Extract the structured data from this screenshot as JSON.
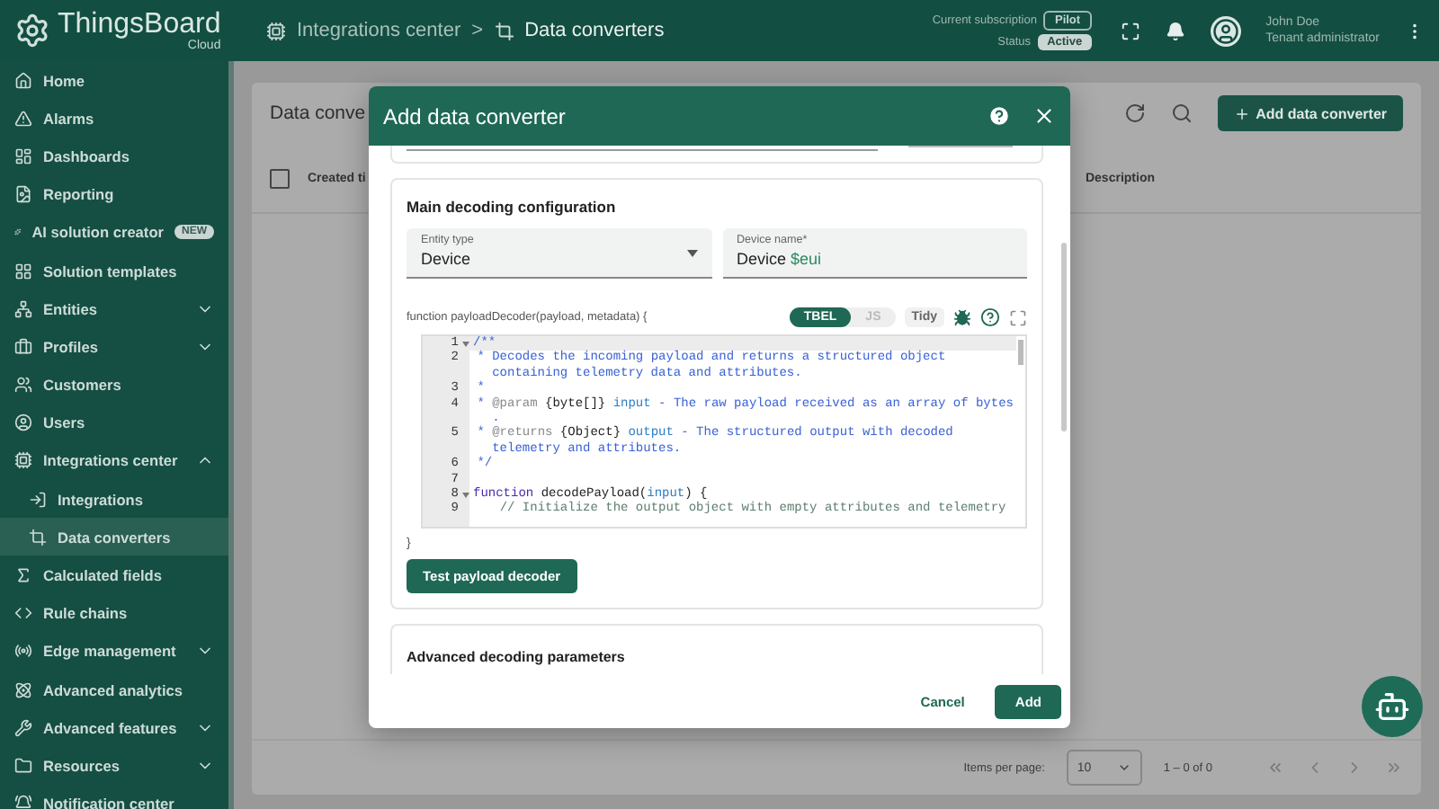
{
  "header": {
    "brand": "ThingsBoard",
    "brand_sub": "Cloud",
    "breadcrumb": [
      {
        "label": "Integrations center"
      },
      {
        "label": "Data converters"
      }
    ],
    "separator": ">",
    "subscription": {
      "label": "Current subscription",
      "value": "Pilot"
    },
    "status": {
      "label": "Status",
      "value": "Active"
    },
    "user": {
      "name": "John Doe",
      "role": "Tenant administrator"
    }
  },
  "sidebar": {
    "items": [
      {
        "label": "Home",
        "selected": false
      },
      {
        "label": "Alarms",
        "selected": false
      },
      {
        "label": "Dashboards",
        "selected": false
      },
      {
        "label": "Reporting",
        "selected": false
      },
      {
        "label": "AI solution creator",
        "badge": "NEW",
        "selected": false
      },
      {
        "label": "Solution templates",
        "selected": false
      },
      {
        "label": "Entities",
        "expanded": false,
        "selected": false
      },
      {
        "label": "Profiles",
        "expanded": false,
        "selected": false
      },
      {
        "label": "Customers",
        "selected": false
      },
      {
        "label": "Users",
        "selected": false
      },
      {
        "label": "Integrations center",
        "expanded": true,
        "selected": false,
        "children": [
          {
            "label": "Integrations",
            "selected": false
          },
          {
            "label": "Data converters",
            "selected": true
          }
        ]
      },
      {
        "label": "Calculated fields",
        "selected": false
      },
      {
        "label": "Rule chains",
        "selected": false
      },
      {
        "label": "Edge management",
        "expanded": false,
        "selected": false
      },
      {
        "label": "Advanced analytics",
        "selected": false
      },
      {
        "label": "Advanced features",
        "expanded": false,
        "selected": false
      },
      {
        "label": "Resources",
        "expanded": false,
        "selected": false
      },
      {
        "label": "Notification center",
        "selected": false
      }
    ]
  },
  "page": {
    "title": "Data conve",
    "select_all": {
      "checked": false
    },
    "add_button": "Add data converter",
    "columns": [
      "Created ti",
      "Description"
    ],
    "pagination": {
      "label": "Items per page:",
      "page_size": "10",
      "range": "1 – 0 of 0"
    }
  },
  "dialog": {
    "title": "Add data converter",
    "main_section": {
      "title": "Main decoding configuration",
      "entity_type": {
        "label": "Entity type",
        "value": "Device"
      },
      "device_name": {
        "label": "Device name*",
        "value_parts": [
          {
            "text": "Device ",
            "kind": "plain"
          },
          {
            "text": "$eui",
            "kind": "variable"
          }
        ]
      },
      "decoder": {
        "signature": "function payloadDecoder(payload, metadata) {",
        "languages": [
          {
            "label": "TBEL",
            "selected": true
          },
          {
            "label": "JS",
            "selected": false
          }
        ],
        "tidy_label": "Tidy",
        "closing": "}",
        "lines": [
          {
            "number": "1",
            "fold": true,
            "parts": [
              {
                "kind": "comment",
                "text": "/**"
              }
            ]
          },
          {
            "number": "2",
            "fold": false,
            "parts": [
              {
                "kind": "comment",
                "text": " * Decodes the incoming payload and returns a structured object containing telemetry data and attributes."
              }
            ]
          },
          {
            "number": "3",
            "fold": false,
            "parts": [
              {
                "kind": "comment",
                "text": " *"
              }
            ]
          },
          {
            "number": "4",
            "fold": false,
            "parts": [
              {
                "kind": "comment",
                "text": " * "
              },
              {
                "kind": "tag",
                "text": "@param "
              },
              {
                "kind": "type",
                "text": "{byte[]} "
              },
              {
                "kind": "param",
                "text": "input"
              },
              {
                "kind": "comment",
                "text": " - The raw payload received as an array of bytes ."
              }
            ]
          },
          {
            "number": "5",
            "fold": false,
            "parts": [
              {
                "kind": "comment",
                "text": " * "
              },
              {
                "kind": "tag",
                "text": "@returns "
              },
              {
                "kind": "type",
                "text": "{Object} "
              },
              {
                "kind": "param",
                "text": "output"
              },
              {
                "kind": "comment",
                "text": " - The structured output with decoded telemetry and attributes."
              }
            ]
          },
          {
            "number": "6",
            "fold": false,
            "parts": [
              {
                "kind": "comment",
                "text": " */"
              }
            ]
          },
          {
            "number": "7",
            "fold": false
          },
          {
            "number": "8",
            "fold": true,
            "parts": [
              {
                "kind": "keyword",
                "text": "function "
              },
              {
                "kind": "name",
                "text": "decodePayload"
              },
              {
                "kind": "plain",
                "text": "("
              },
              {
                "kind": "param",
                "text": "input"
              },
              {
                "kind": "plain",
                "text": ") {"
              }
            ]
          },
          {
            "number": "9",
            "fold": false,
            "parts": [
              {
                "kind": "linecomment",
                "text": "    // Initialize the output object with empty attributes and telemetry"
              }
            ]
          }
        ]
      },
      "test_button": "Test payload decoder"
    },
    "advanced_section": {
      "title": "Advanced decoding parameters"
    },
    "buttons": [
      {
        "label": "Cancel",
        "kind": "text"
      },
      {
        "label": "Add",
        "kind": "primary"
      }
    ]
  }
}
